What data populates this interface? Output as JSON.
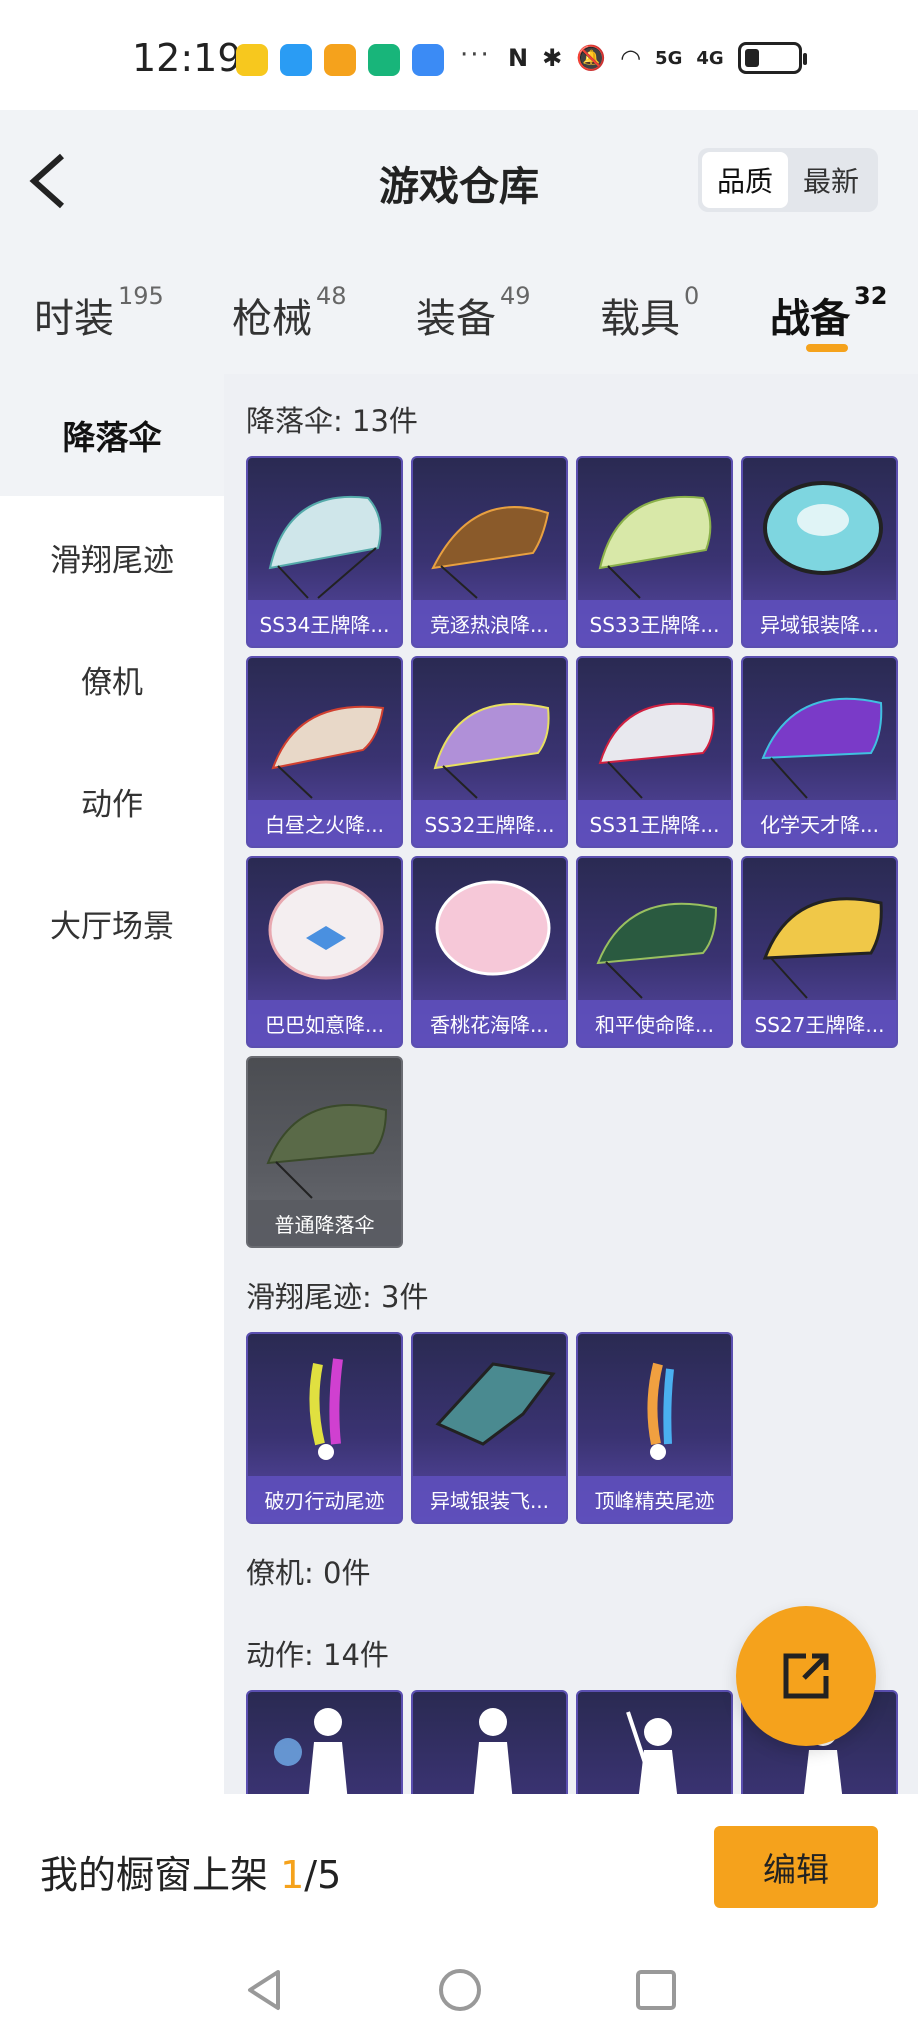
{
  "status_bar": {
    "time": "12:19",
    "ellipsis": "···",
    "network_5g": "5G",
    "network_4g": "4G"
  },
  "header": {
    "title": "游戏仓库",
    "sort_quality": "品质",
    "sort_newest": "最新"
  },
  "tabs": [
    {
      "label": "时装",
      "count": "195"
    },
    {
      "label": "枪械",
      "count": "48"
    },
    {
      "label": "装备",
      "count": "49"
    },
    {
      "label": "载具",
      "count": "0"
    },
    {
      "label": "战备",
      "count": "32"
    }
  ],
  "sidebar": {
    "items": [
      {
        "label": "降落伞"
      },
      {
        "label": "滑翔尾迹"
      },
      {
        "label": "僚机"
      },
      {
        "label": "动作"
      },
      {
        "label": "大厅场景"
      }
    ]
  },
  "sections": {
    "parachute": {
      "title": "降落伞: 13件",
      "items": [
        {
          "label": "SS34王牌降..."
        },
        {
          "label": "竞逐热浪降..."
        },
        {
          "label": "SS33王牌降..."
        },
        {
          "label": "异域银装降..."
        },
        {
          "label": "白昼之火降..."
        },
        {
          "label": "SS32王牌降..."
        },
        {
          "label": "SS31王牌降..."
        },
        {
          "label": "化学天才降..."
        },
        {
          "label": "巴巴如意降..."
        },
        {
          "label": "香桃花海降..."
        },
        {
          "label": "和平使命降..."
        },
        {
          "label": "SS27王牌降..."
        },
        {
          "label": "普通降落伞"
        }
      ]
    },
    "trail": {
      "title": "滑翔尾迹: 3件",
      "items": [
        {
          "label": "破刃行动尾迹"
        },
        {
          "label": "异域银装飞..."
        },
        {
          "label": "顶峰精英尾迹"
        }
      ]
    },
    "wingman": {
      "title": "僚机: 0件"
    },
    "emote": {
      "title": "动作: 14件"
    }
  },
  "bottom": {
    "window_label": "我的橱窗上架",
    "window_current": "1",
    "window_total": "/5",
    "edit_label": "编辑"
  },
  "colors": {
    "accent": "#f5a21c",
    "card_purple": "#3a3372",
    "background": "#f1f3f6"
  }
}
